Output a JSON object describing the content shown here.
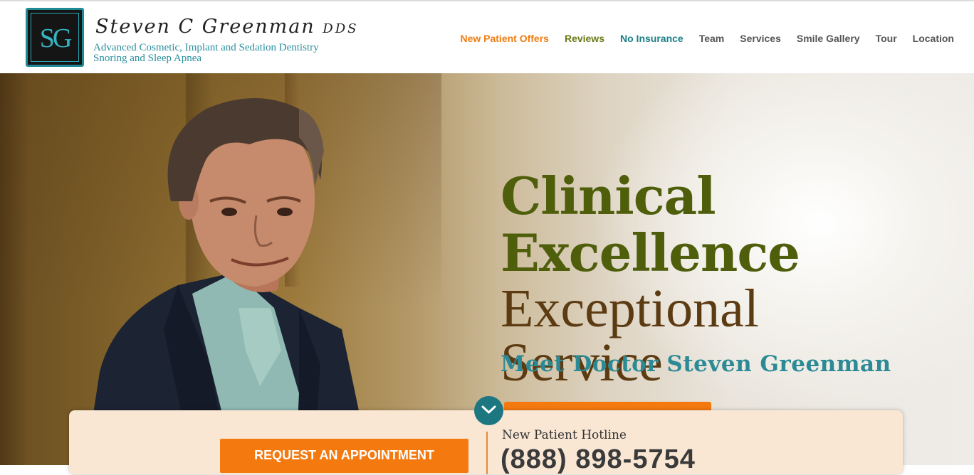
{
  "logo": {
    "monogram": "SG",
    "name": "Steven C Greenman",
    "suffix": "DDS",
    "tagline_1": "Advanced Cosmetic, Implant and Sedation Dentistry",
    "tagline_2": "Snoring and Sleep Apnea"
  },
  "nav": {
    "items": [
      {
        "label": "New Patient Offers",
        "color": "#ef7d12"
      },
      {
        "label": "Reviews",
        "color": "#6b7a16"
      },
      {
        "label": "No Insurance",
        "color": "#1b7f86"
      },
      {
        "label": "Team",
        "color": "#555555"
      },
      {
        "label": "Services",
        "color": "#555555"
      },
      {
        "label": "Smile Gallery",
        "color": "#555555"
      },
      {
        "label": "Tour",
        "color": "#555555"
      },
      {
        "label": "Location",
        "color": "#555555"
      }
    ]
  },
  "hero": {
    "line1": "Clinical",
    "line2": "Excellence",
    "line3": "Exceptional",
    "line4": "Service",
    "meet": "Meet Doctor Steven Greenman",
    "scroll_icon": "chevron-down-icon"
  },
  "cta": {
    "appointment_label": "REQUEST AN APPOINTMENT",
    "hotline_label": "New Patient Hotline",
    "hotline_number": "(888) 898-5754"
  },
  "colors": {
    "accent_orange": "#f47a10",
    "accent_green": "#4e5e0b",
    "accent_brown": "#5c3b12",
    "accent_teal": "#2b8a95"
  }
}
